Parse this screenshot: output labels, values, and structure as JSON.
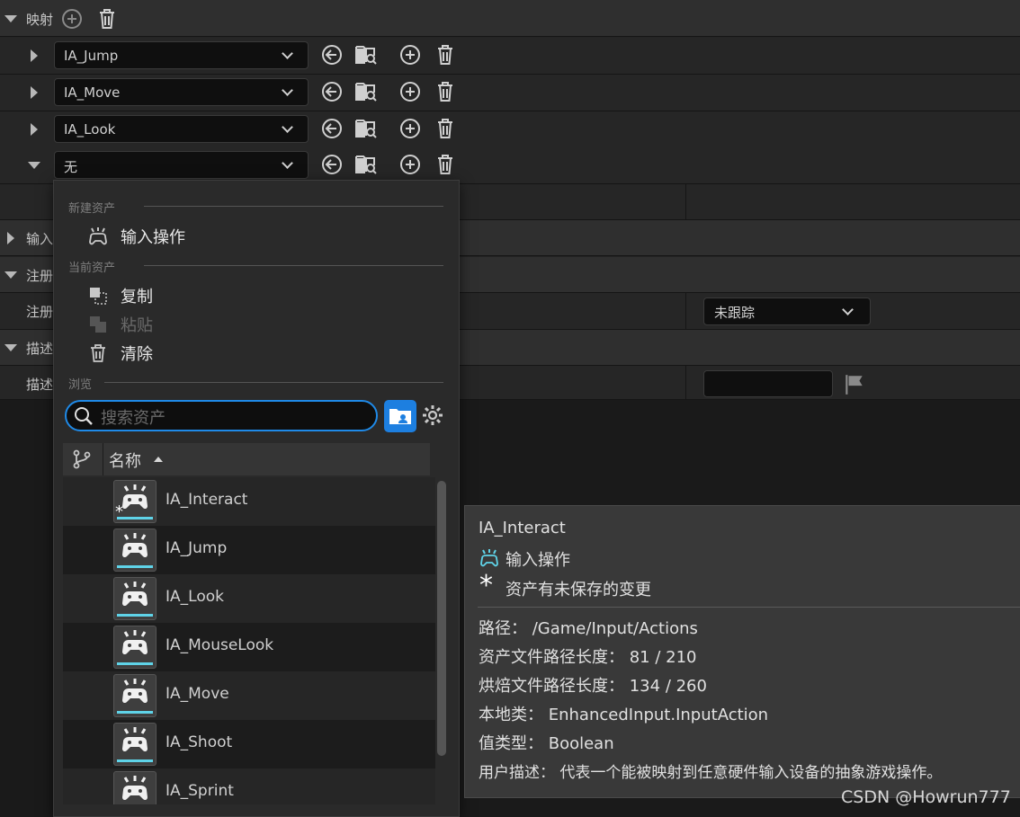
{
  "mappings": {
    "label": "映射",
    "rows": [
      {
        "value": "IA_Jump",
        "expanded": false
      },
      {
        "value": "IA_Move",
        "expanded": false
      },
      {
        "value": "IA_Look",
        "expanded": false
      },
      {
        "value": "无",
        "expanded": true
      }
    ]
  },
  "sections": {
    "input_label": "输入",
    "register_label": "注册",
    "register_sub_label": "注册",
    "description_label": "描述",
    "description_sub_label": "描述",
    "tracking_value": "未跟踪"
  },
  "menu": {
    "new_asset_header": "新建资产",
    "input_action_label": "输入操作",
    "current_asset_header": "当前资产",
    "copy_label": "复制",
    "paste_label": "粘贴",
    "clear_label": "清除",
    "browse_header": "浏览",
    "search_placeholder": "搜索资产",
    "column_name": "名称",
    "assets": [
      {
        "name": "IA_Interact",
        "unsaved": true
      },
      {
        "name": "IA_Jump",
        "unsaved": false
      },
      {
        "name": "IA_Look",
        "unsaved": false
      },
      {
        "name": "IA_MouseLook",
        "unsaved": false
      },
      {
        "name": "IA_Move",
        "unsaved": false
      },
      {
        "name": "IA_Shoot",
        "unsaved": false
      },
      {
        "name": "IA_Sprint",
        "unsaved": false
      }
    ]
  },
  "tooltip": {
    "title": "IA_Interact",
    "type_label": "输入操作",
    "unsaved_label": "资产有未保存的变更",
    "path_key": "路径：",
    "path_value": "/Game/Input/Actions",
    "asset_path_len_key": "资产文件路径长度：",
    "asset_path_len_value": "81 / 210",
    "cooked_path_len_key": "烘焙文件路径长度：",
    "cooked_path_len_value": "134 / 260",
    "native_class_key": "本地类：",
    "native_class_value": "EnhancedInput.InputAction",
    "value_type_key": "值类型：",
    "value_type_value": "Boolean",
    "user_desc_key": "用户描述：",
    "user_desc_value": "代表一个能被映射到任意硬件输入设备的抽象游戏操作。"
  },
  "colors": {
    "accent": "#1d7fe0",
    "cyan": "#5fd3e8"
  },
  "watermark": "CSDN @Howrun777"
}
